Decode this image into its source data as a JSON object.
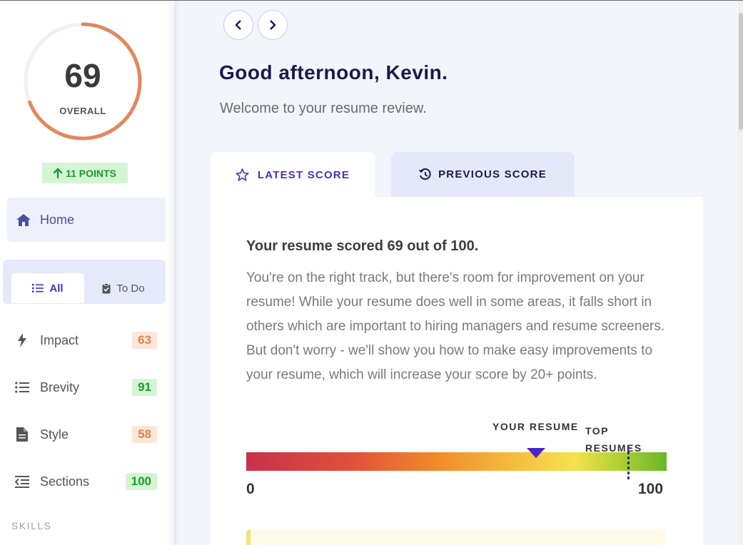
{
  "sidebar": {
    "overall_score": "69",
    "overall_label": "OVERALL",
    "score_fraction": 0.69,
    "points_change": "11 POINTS",
    "home_label": "Home",
    "filter_all_label": "All",
    "filter_todo_label": "To Do",
    "categories": [
      {
        "label": "Impact",
        "score": "63",
        "icon": "lightning-icon",
        "status": "orange"
      },
      {
        "label": "Brevity",
        "score": "91",
        "icon": "list-icon",
        "status": "green"
      },
      {
        "label": "Style",
        "score": "58",
        "icon": "document-icon",
        "status": "orange"
      },
      {
        "label": "Sections",
        "score": "100",
        "icon": "sections-icon",
        "status": "green"
      }
    ],
    "skills_heading": "SKILLS"
  },
  "header": {
    "greeting": "Good afternoon, Kevin.",
    "welcome": "Welcome to your resume review."
  },
  "tabs": {
    "latest": "LATEST SCORE",
    "previous": "PREVIOUS SCORE"
  },
  "review": {
    "title": "Your resume scored 69 out of 100.",
    "description": "You're on the right track, but there's room for improvement on your resume! While your resume does well in some areas, it falls short in others which are important to hiring managers and resume screeners. But don't worry - we'll show you how to make easy improvements to your resume, which will increase your score by 20+ points."
  },
  "score_bar": {
    "your_label": "YOUR RESUME",
    "top_label": "TOP RESUMES",
    "min_label": "0",
    "max_label": "100",
    "your_value": 69,
    "top_value": 91
  },
  "colors": {
    "accent": "#4a2ec0",
    "ring": "#e0885e",
    "success": "#1b9a2c",
    "warning": "#e0824b"
  }
}
